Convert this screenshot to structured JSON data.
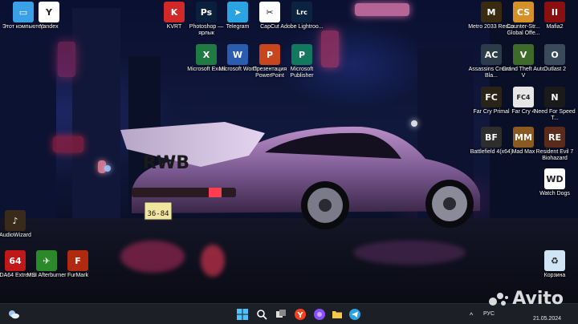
{
  "wallpaper": {
    "car_wing_text": "RWB",
    "plate_text": "36-84"
  },
  "desktop_icons": [
    {
      "id": "this-pc",
      "label": "Этот компьютер",
      "color": "#3aa0e8",
      "glyph": "▭"
    },
    {
      "id": "yandex",
      "label": "Yandex",
      "color": "#ffffff",
      "glyph": "Y"
    },
    {
      "id": "kvrt",
      "label": "KVRT",
      "color": "#d22828",
      "glyph": "K"
    },
    {
      "id": "photoshop",
      "label": "Photoshop — ярлык",
      "color": "#0a1f3c",
      "glyph": "Ps"
    },
    {
      "id": "telegram",
      "label": "Telegram",
      "color": "#2aa3e0",
      "glyph": "➤"
    },
    {
      "id": "capcut",
      "label": "CapCut",
      "color": "#ffffff",
      "glyph": "✂"
    },
    {
      "id": "lightroom",
      "label": "Adobe Lightroo...",
      "color": "#0b2340",
      "glyph": "Lrc"
    },
    {
      "id": "excel",
      "label": "Microsoft Excel",
      "color": "#1f7a44",
      "glyph": "X"
    },
    {
      "id": "word",
      "label": "Microsoft Word",
      "color": "#2a5db0",
      "glyph": "W"
    },
    {
      "id": "powerpoint",
      "label": "Презентация PowerPoint",
      "color": "#c8461e",
      "glyph": "P"
    },
    {
      "id": "publisher",
      "label": "Microsoft Publisher",
      "color": "#12795f",
      "glyph": "P"
    },
    {
      "id": "metro",
      "label": "Metro 2033 Redux",
      "color": "#3a2a10",
      "glyph": "M"
    },
    {
      "id": "cs",
      "label": "Counter-Str... Global Offe...",
      "color": "#d6902a",
      "glyph": "CS"
    },
    {
      "id": "mafia2",
      "label": "Mafia2",
      "color": "#8a1010",
      "glyph": "II"
    },
    {
      "id": "assassins",
      "label": "Assassins Creed - Bla...",
      "color": "#2b3b4a",
      "glyph": "AC"
    },
    {
      "id": "gta",
      "label": "Grand Theft Auto V",
      "color": "#3f6b2a",
      "glyph": "V"
    },
    {
      "id": "outlast",
      "label": "Outlast 2",
      "color": "#3a4a5a",
      "glyph": "O"
    },
    {
      "id": "farcry-primal",
      "label": "Far Cry Primal",
      "color": "#2a2418",
      "glyph": "FC"
    },
    {
      "id": "farcry4",
      "label": "Far Cry 4",
      "color": "#e6e6e6",
      "glyph": "FC4"
    },
    {
      "id": "nfs",
      "label": "Need For Speed T...",
      "color": "#1a1a1a",
      "glyph": "N"
    },
    {
      "id": "battlefield",
      "label": "Battlefield 4(x64)",
      "color": "#2d2d2d",
      "glyph": "BF"
    },
    {
      "id": "madmax",
      "label": "Mad Max",
      "color": "#8a5a20",
      "glyph": "MM"
    },
    {
      "id": "re7",
      "label": "Resident Evil 7 Biohazard",
      "color": "#5a2a1a",
      "glyph": "RE"
    },
    {
      "id": "watchdogs",
      "label": "Watch Dogs",
      "color": "#ffffff",
      "glyph": "WD"
    },
    {
      "id": "audiowizard",
      "label": "AudioWizard",
      "color": "#3a2a1a",
      "glyph": "♪"
    },
    {
      "id": "aida64",
      "label": "AIDA64 Extreme",
      "color": "#c01818",
      "glyph": "64"
    },
    {
      "id": "afterburner",
      "label": "MSI Afterburner",
      "color": "#2a8a2a",
      "glyph": "✈"
    },
    {
      "id": "furmark",
      "label": "FurMark",
      "color": "#b02a10",
      "glyph": "F"
    },
    {
      "id": "recycle",
      "label": "Корзина",
      "color": "#cfe4f4",
      "glyph": "♻"
    }
  ],
  "taskbar": {
    "widgets_icon": "weather-icon",
    "pinned": [
      {
        "id": "start",
        "icon": "windows-logo-icon"
      },
      {
        "id": "search",
        "icon": "search-icon"
      },
      {
        "id": "taskview",
        "icon": "task-view-icon"
      },
      {
        "id": "yandex",
        "icon": "yandex-icon"
      },
      {
        "id": "alice",
        "icon": "alice-icon"
      },
      {
        "id": "explorer",
        "icon": "folder-icon"
      },
      {
        "id": "telegram",
        "icon": "telegram-icon"
      }
    ],
    "tray": {
      "chevron": "^",
      "language": "РУС",
      "date": "21.05.2024"
    }
  },
  "watermark": {
    "text": "Avito"
  }
}
